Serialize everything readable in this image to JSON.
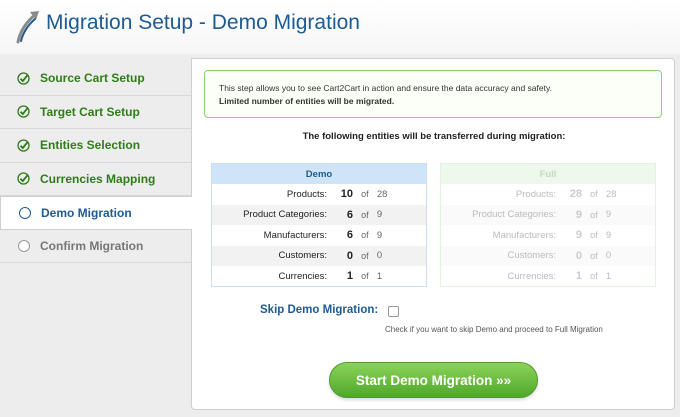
{
  "header": {
    "title": "Migration Setup - Demo Migration",
    "logo_icon": "arrow-logo-icon"
  },
  "colors": {
    "accent_blue": "#1d5b93",
    "done_green": "#2f7d18",
    "button_green": "#4fa829"
  },
  "sidebar": {
    "items": [
      {
        "label": "Source Cart Setup",
        "state": "done"
      },
      {
        "label": "Target Cart Setup",
        "state": "done"
      },
      {
        "label": "Entities Selection",
        "state": "done"
      },
      {
        "label": "Currencies Mapping",
        "state": "done"
      },
      {
        "label": "Demo Migration",
        "state": "active"
      },
      {
        "label": "Confirm Migration",
        "state": "pending"
      }
    ]
  },
  "notice": {
    "line1": "This step allows you to see Cart2Cart in action and ensure the data accuracy and safety.",
    "line2": "Limited number of entities will be migrated."
  },
  "subtitle": "The following entities will be transferred during migration:",
  "demo_table": {
    "header": "Demo",
    "of_label": "of",
    "rows": [
      {
        "label": "Products:",
        "value": "10",
        "total": "28"
      },
      {
        "label": "Product Categories:",
        "value": "6",
        "total": "9"
      },
      {
        "label": "Manufacturers:",
        "value": "6",
        "total": "9"
      },
      {
        "label": "Customers:",
        "value": "0",
        "total": "0"
      },
      {
        "label": "Currencies:",
        "value": "1",
        "total": "1"
      }
    ]
  },
  "full_table": {
    "header": "Full",
    "of_label": "of",
    "rows": [
      {
        "label": "Products:",
        "value": "28",
        "total": "28"
      },
      {
        "label": "Product Categories:",
        "value": "9",
        "total": "9"
      },
      {
        "label": "Manufacturers:",
        "value": "9",
        "total": "9"
      },
      {
        "label": "Customers:",
        "value": "0",
        "total": "0"
      },
      {
        "label": "Currencies:",
        "value": "1",
        "total": "1"
      }
    ]
  },
  "skip": {
    "label": "Skip Demo Migration:",
    "checked": false,
    "hint": "Check if you want to skip Demo and proceed to Full Migration"
  },
  "start_button": {
    "label": "Start Demo Migration »»"
  }
}
